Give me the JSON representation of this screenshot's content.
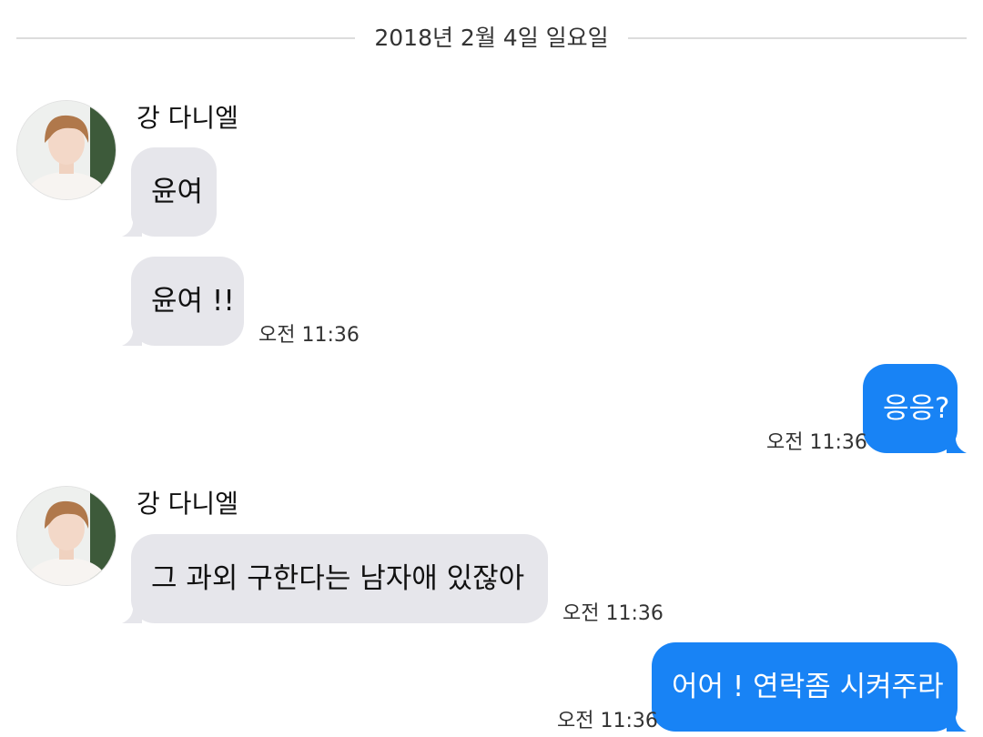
{
  "date_divider": "2018년 2월 4일 일요일",
  "sender": {
    "name": "강 다니엘",
    "avatar_icon": "profile-photo"
  },
  "colors": {
    "incoming_bubble": "#e6e6eb",
    "outgoing_bubble": "#1883f5",
    "divider": "#dcdcdc"
  },
  "messages": [
    {
      "direction": "incoming",
      "text": "윤여",
      "time": ""
    },
    {
      "direction": "incoming",
      "text": "윤여 !!",
      "time": "오전 11:36"
    },
    {
      "direction": "outgoing",
      "text": "응응?",
      "time": "오전 11:36"
    },
    {
      "direction": "incoming",
      "text": "그 과외 구한다는 남자애 있잖아",
      "time": "오전 11:36"
    },
    {
      "direction": "outgoing",
      "text": "어어 ! 연락좀 시켜주라",
      "time": "오전 11:36"
    }
  ]
}
